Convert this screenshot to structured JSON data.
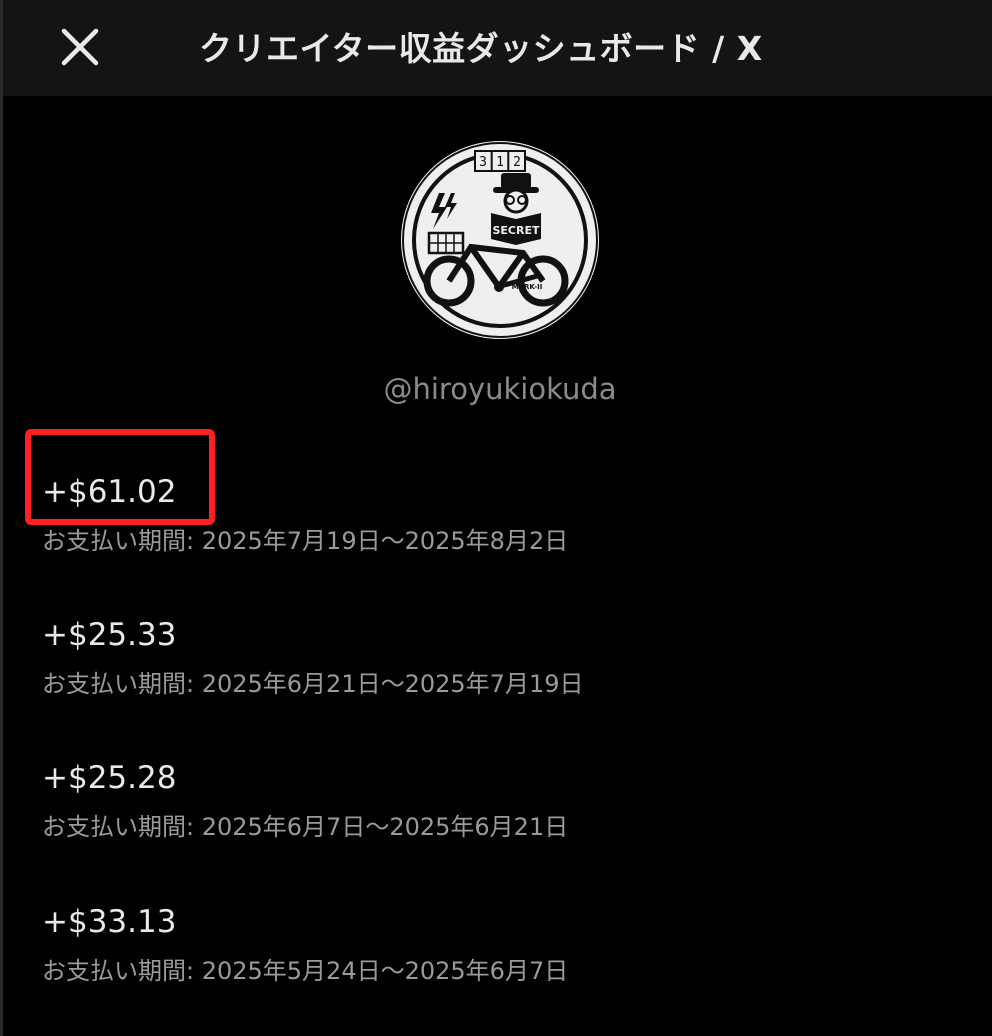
{
  "header": {
    "title": "クリエイター収益ダッシュボード / X",
    "close_icon": "close-icon"
  },
  "profile": {
    "username": "@hiroyukiokuda",
    "avatar_text": {
      "counter": [
        "3",
        "1",
        "2"
      ],
      "sign": "SECRET",
      "bike_label": "MARK-II"
    }
  },
  "payouts": [
    {
      "amount": "+$61.02",
      "period": "お支払い期間: 2025年7月19日〜2025年8月2日"
    },
    {
      "amount": "+$25.33",
      "period": "お支払い期間: 2025年6月21日〜2025年7月19日"
    },
    {
      "amount": "+$25.28",
      "period": "お支払い期間: 2025年6月7日〜2025年6月21日"
    },
    {
      "amount": "+$33.13",
      "period": "お支払い期間: 2025年5月24日〜2025年6月7日"
    }
  ],
  "colors": {
    "background": "#000000",
    "header_background": "#141414",
    "highlight": "#ff2020",
    "primary_text": "#e7e9ea",
    "secondary_text": "#9a9a9a"
  }
}
